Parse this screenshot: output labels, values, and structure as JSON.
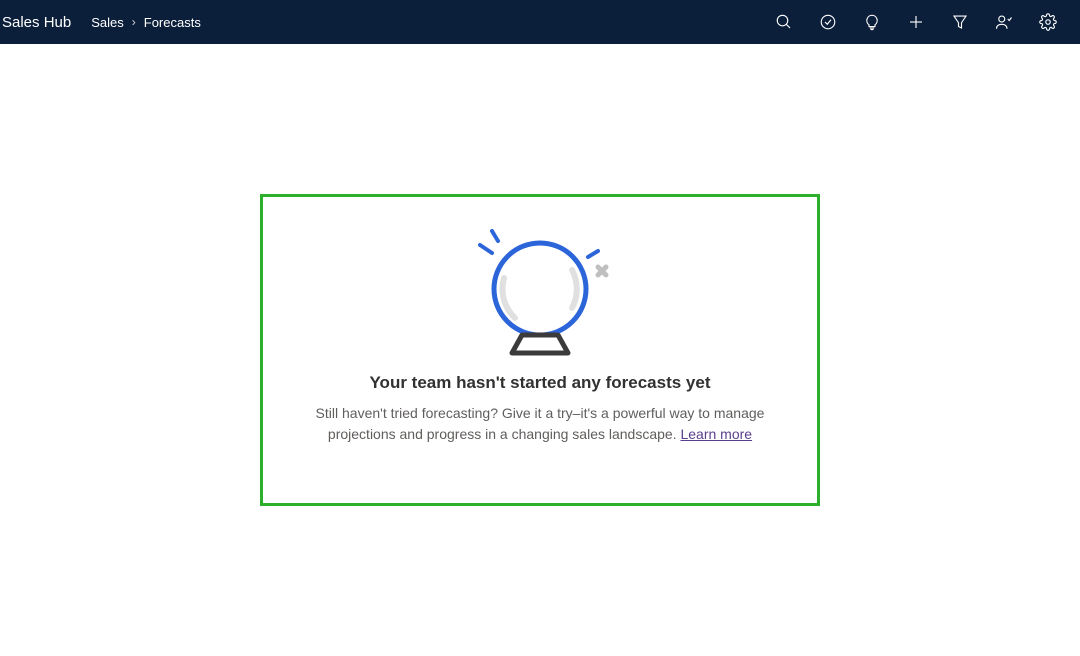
{
  "header": {
    "app_name": "Sales Hub",
    "breadcrumb": {
      "parent": "Sales",
      "current": "Forecasts"
    },
    "icons": {
      "search": "search",
      "task": "task",
      "lightbulb": "lightbulb",
      "add": "add",
      "filter": "filter",
      "assistant": "assistant",
      "settings": "settings"
    }
  },
  "empty": {
    "title": "Your team hasn't started any forecasts yet",
    "body": "Still haven't tried forecasting? Give it a try–it's a powerful way to manage projections and progress in a changing sales landscape. ",
    "link_text": "Learn more"
  },
  "colors": {
    "header_bg": "#0b1f3a",
    "card_border": "#2cb02c",
    "link": "#5b3f8c"
  }
}
